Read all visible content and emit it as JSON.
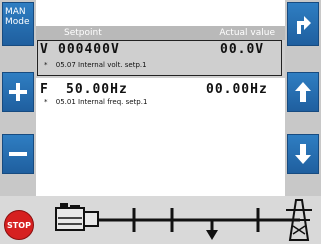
{
  "left_panel": {
    "mode_label_line1": "MAN",
    "mode_label_line2": "Mode"
  },
  "table": {
    "header": {
      "setpoint": "Setpoint",
      "actual": "Actual value"
    },
    "rows": [
      {
        "id": "V",
        "setpoint": "000400V",
        "actual": "00.0V",
        "marker": "*",
        "description": "05.07 Internal volt. setp.1"
      },
      {
        "id": "F",
        "setpoint": "50.00Hz",
        "actual": "00.00Hz",
        "marker": "*",
        "description": "05.01 Internal freq. setp.1"
      }
    ]
  },
  "footer": {
    "stop_label": "STOP"
  },
  "icons": {
    "plus": "plus-icon",
    "minus": "minus-icon",
    "arrow_up_right": "arrow-up-right-icon",
    "arrow_up": "arrow-up-icon",
    "arrow_down": "arrow-down-icon",
    "generator": "generator-icon",
    "breaker": "breaker-icon",
    "grid": "grid-icon"
  },
  "colors": {
    "button_blue": "#1f5f9f",
    "stop_red": "#d62020",
    "header_gray": "#b9b9b9"
  }
}
